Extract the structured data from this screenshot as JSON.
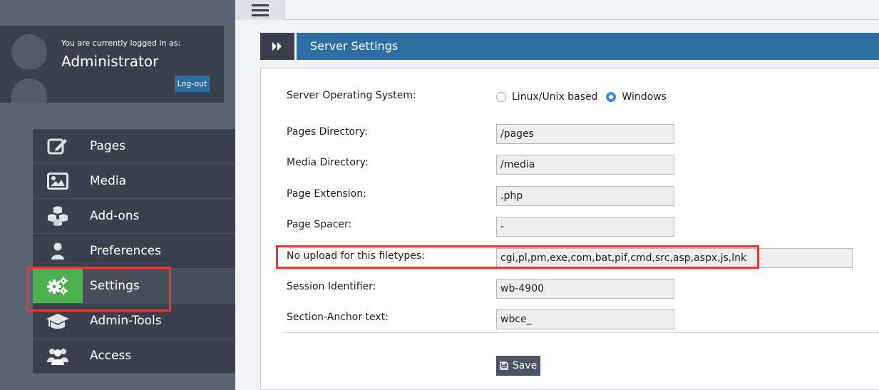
{
  "user": {
    "logged_in_text": "You are currently logged in as:",
    "name": "Administrator",
    "logout_label": "Log-out"
  },
  "nav": {
    "items": [
      {
        "label": "Pages",
        "icon": "edit-icon"
      },
      {
        "label": "Media",
        "icon": "image-icon"
      },
      {
        "label": "Add-ons",
        "icon": "cubes-icon"
      },
      {
        "label": "Preferences",
        "icon": "user-icon"
      },
      {
        "label": "Settings",
        "icon": "gears-icon",
        "active": true
      },
      {
        "label": "Admin-Tools",
        "icon": "graduation-cap-icon"
      },
      {
        "label": "Access",
        "icon": "users-icon"
      }
    ]
  },
  "header": {
    "title": "Server Settings",
    "icon": "double-chevron-right-icon"
  },
  "form": {
    "os": {
      "label": "Server Operating System:",
      "options": [
        "Linux/Unix based",
        "Windows"
      ],
      "selected": "Windows"
    },
    "pages_dir": {
      "label": "Pages Directory:",
      "value": "/pages"
    },
    "media_dir": {
      "label": "Media Directory:",
      "value": "/media"
    },
    "page_ext": {
      "label": "Page Extension:",
      "value": ".php"
    },
    "page_spacer": {
      "label": "Page Spacer:",
      "value": "-"
    },
    "no_upload": {
      "label": "No upload for this filetypes:",
      "value": "cgi,pl,pm,exe,com,bat,pif,cmd,src,asp,aspx,js,lnk"
    },
    "session_id": {
      "label": "Session Identifier:",
      "value": "wb-4900"
    },
    "anchor_text": {
      "label": "Section-Anchor text:",
      "value": "wbce_"
    },
    "save_label": "Save"
  },
  "colors": {
    "sidebar_bg": "#5a6472",
    "nav_bg": "#3a414c",
    "active_green": "#4caf50",
    "header_blue": "#2f6ea3",
    "highlight_red": "#e53935"
  }
}
